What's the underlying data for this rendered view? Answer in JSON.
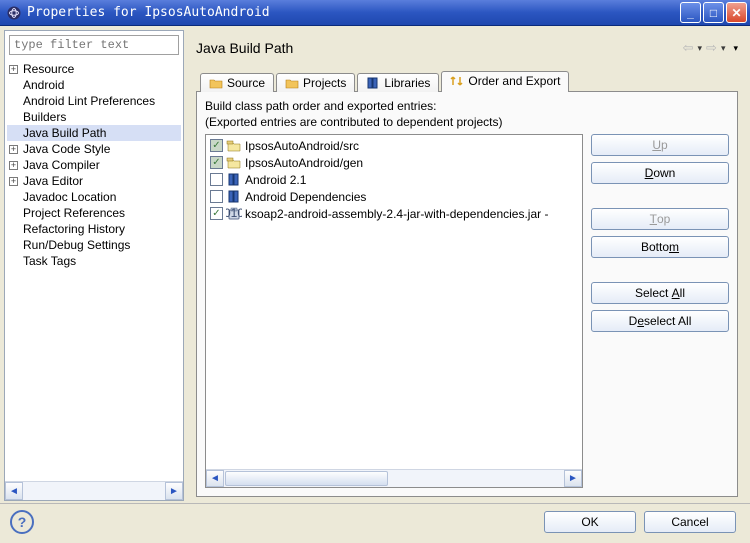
{
  "window": {
    "title": "Properties for IpsosAutoAndroid"
  },
  "filter": {
    "placeholder": "type filter text"
  },
  "tree": {
    "items": [
      {
        "label": "Resource",
        "exp": "+",
        "depth": 0
      },
      {
        "label": "Android",
        "exp": "",
        "depth": 0
      },
      {
        "label": "Android Lint Preferences",
        "exp": "",
        "depth": 0
      },
      {
        "label": "Builders",
        "exp": "",
        "depth": 0
      },
      {
        "label": "Java Build Path",
        "exp": "",
        "depth": 0,
        "selected": true
      },
      {
        "label": "Java Code Style",
        "exp": "+",
        "depth": 0
      },
      {
        "label": "Java Compiler",
        "exp": "+",
        "depth": 0
      },
      {
        "label": "Java Editor",
        "exp": "+",
        "depth": 0
      },
      {
        "label": "Javadoc Location",
        "exp": "",
        "depth": 0
      },
      {
        "label": "Project References",
        "exp": "",
        "depth": 0
      },
      {
        "label": "Refactoring History",
        "exp": "",
        "depth": 0
      },
      {
        "label": "Run/Debug Settings",
        "exp": "",
        "depth": 0
      },
      {
        "label": "Task Tags",
        "exp": "",
        "depth": 0
      }
    ]
  },
  "page": {
    "title": "Java Build Path"
  },
  "tabs": {
    "source": "Source",
    "projects": "Projects",
    "libraries": "Libraries",
    "order": "Order and Export"
  },
  "desc": {
    "line1": "Build class path order and exported entries:",
    "line2": "(Exported entries are contributed to dependent projects)"
  },
  "entries": [
    {
      "label": "IpsosAutoAndroid/src",
      "checked": true,
      "filled": true,
      "icon": "pkg"
    },
    {
      "label": "IpsosAutoAndroid/gen",
      "checked": true,
      "filled": true,
      "icon": "pkg"
    },
    {
      "label": "Android 2.1",
      "checked": false,
      "filled": false,
      "icon": "book"
    },
    {
      "label": "Android Dependencies",
      "checked": false,
      "filled": false,
      "icon": "book"
    },
    {
      "label": "ksoap2-android-assembly-2.4-jar-with-dependencies.jar -",
      "checked": true,
      "filled": false,
      "icon": "jar"
    }
  ],
  "buttons": {
    "up": "Up",
    "down": "Down",
    "top": "Top",
    "bottom": "Bottom",
    "select_all": "Select All",
    "deselect_all": "Deselect All",
    "ok": "OK",
    "cancel": "Cancel"
  }
}
